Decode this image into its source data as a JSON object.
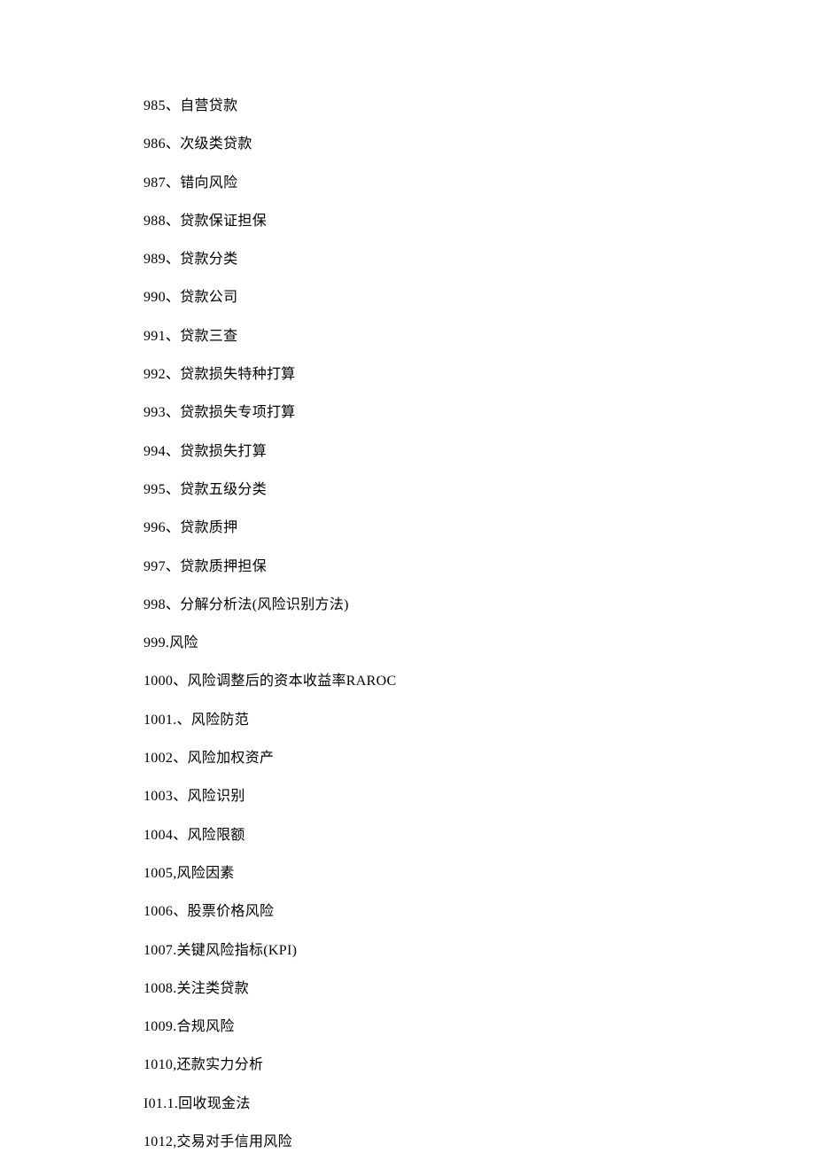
{
  "items": [
    "985、自营贷款",
    "986、次级类贷款",
    "987、错向风险",
    "988、贷款保证担保",
    "989、贷款分类",
    "990、贷款公司",
    "991、贷款三查",
    "992、贷款损失特种打算",
    "993、贷款损失专项打算",
    "994、贷款损失打算",
    "995、贷款五级分类",
    "996、贷款质押",
    "997、贷款质押担保",
    "998、分解分析法(风险识别方法)",
    "999.风险",
    "1000、风险调整后的资本收益率RAROC",
    "1001.、风险防范",
    "1002、风险加权资产",
    "1003、风险识别",
    "1004、风险限额",
    "1005,风险因素",
    "1006、股票价格风险",
    "1007.关键风险指标(KPI)",
    "1008.关注类贷款",
    "1009.合规风险",
    "1010,还款实力分析",
    "I01.1.回收现金法",
    "1012,交易对手信用风险"
  ]
}
